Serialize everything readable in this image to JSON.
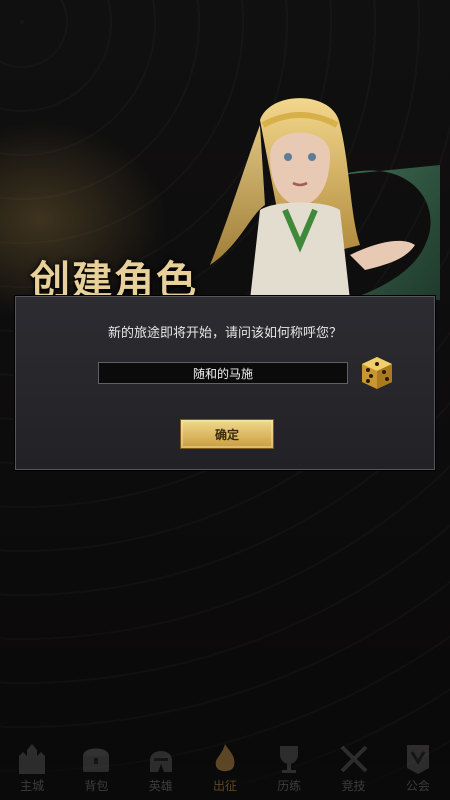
{
  "screen": {
    "title": "创建角色"
  },
  "dialog": {
    "prompt": "新的旅途即将开始，请问该如何称呼您？",
    "name_value": "随和的马施",
    "confirm_label": "确定",
    "dice_icon": "dice-icon"
  },
  "bottom_nav": {
    "items": [
      {
        "label": "主城",
        "icon": "castle-icon"
      },
      {
        "label": "背包",
        "icon": "chest-icon"
      },
      {
        "label": "英雄",
        "icon": "helmet-icon"
      },
      {
        "label": "出征",
        "icon": "flame-icon",
        "active": true
      },
      {
        "label": "历练",
        "icon": "trophy-icon"
      },
      {
        "label": "竞技",
        "icon": "crossed-swords-icon"
      },
      {
        "label": "公会",
        "icon": "banner-icon"
      }
    ]
  },
  "colors": {
    "gold": "#e8d09a",
    "button_gold": "#d8b45a",
    "dialog_bg": "#27272b"
  }
}
